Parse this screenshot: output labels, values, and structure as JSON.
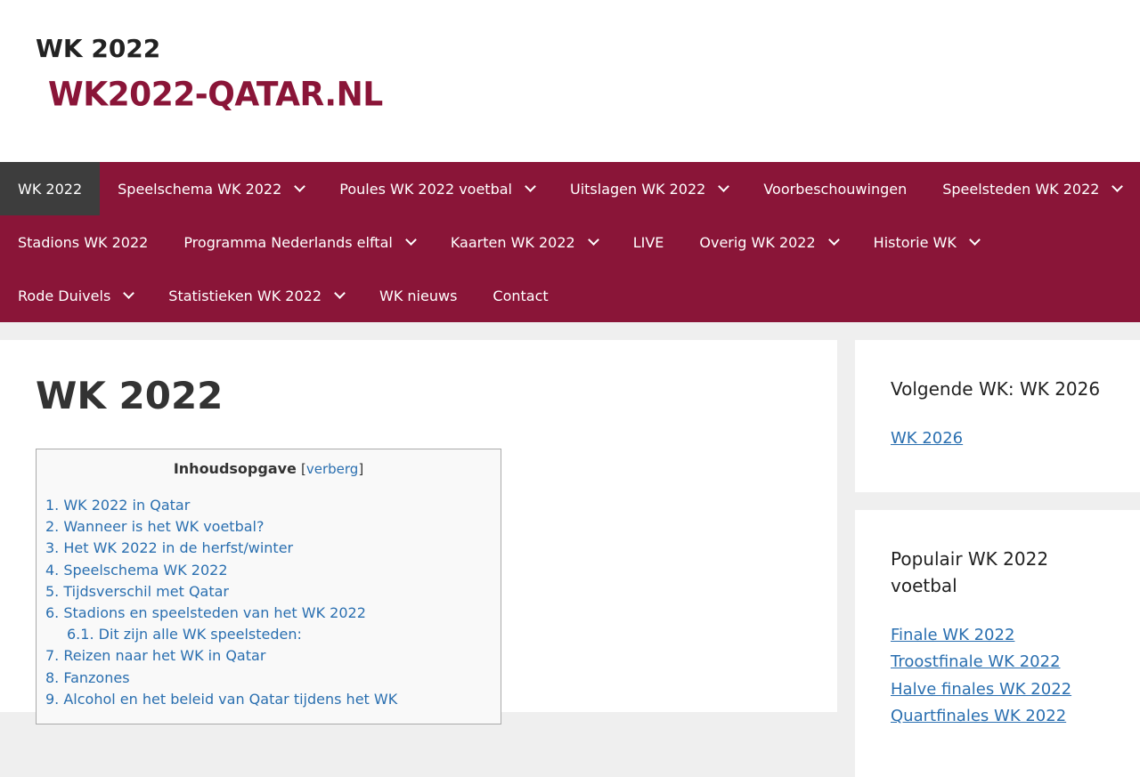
{
  "header": {
    "site_title": "WK 2022",
    "logo_text": "WK2022-QATAR.NL"
  },
  "nav": {
    "items": [
      {
        "label": "WK 2022",
        "dropdown": false,
        "active": true
      },
      {
        "label": "Speelschema WK 2022",
        "dropdown": true
      },
      {
        "label": "Poules WK 2022 voetbal",
        "dropdown": true
      },
      {
        "label": "Uitslagen WK 2022",
        "dropdown": true
      },
      {
        "label": "Voorbeschouwingen",
        "dropdown": false
      },
      {
        "label": "Speelsteden WK 2022",
        "dropdown": true
      },
      {
        "label": "Stadions WK 2022",
        "dropdown": false
      },
      {
        "label": "Programma Nederlands elftal",
        "dropdown": true
      },
      {
        "label": "Kaarten WK 2022",
        "dropdown": true
      },
      {
        "label": "LIVE",
        "dropdown": false
      },
      {
        "label": "Overig WK 2022",
        "dropdown": true
      },
      {
        "label": "Historie WK",
        "dropdown": true
      },
      {
        "label": "Rode Duivels",
        "dropdown": true
      },
      {
        "label": "Statistieken WK 2022",
        "dropdown": true
      },
      {
        "label": "WK nieuws",
        "dropdown": false
      },
      {
        "label": "Contact",
        "dropdown": false
      }
    ]
  },
  "main": {
    "page_title": "WK 2022",
    "toc": {
      "title": "Inhoudsopgave",
      "toggle_open": "[",
      "toggle_label": "verberg",
      "toggle_close": "]",
      "entries": [
        {
          "text": "1. WK 2022 in Qatar",
          "sub": false
        },
        {
          "text": "2. Wanneer is het WK voetbal?",
          "sub": false
        },
        {
          "text": "3. Het WK 2022 in de herfst/winter",
          "sub": false
        },
        {
          "text": "4. Speelschema WK 2022",
          "sub": false
        },
        {
          "text": "5. Tijdsverschil met Qatar",
          "sub": false
        },
        {
          "text": "6. Stadions en speelsteden van het WK 2022",
          "sub": false
        },
        {
          "text": "6.1. Dit zijn alle WK speelsteden:",
          "sub": true
        },
        {
          "text": "7. Reizen naar het WK in Qatar",
          "sub": false
        },
        {
          "text": "8. Fanzones",
          "sub": false
        },
        {
          "text": "9. Alcohol en het beleid van Qatar tijdens het WK",
          "sub": false
        }
      ]
    }
  },
  "sidebar": {
    "widget1": {
      "title": "Volgende WK: WK 2026",
      "links": [
        "WK 2026"
      ]
    },
    "widget2": {
      "title": "Populair WK 2022 voetbal",
      "links": [
        "Finale WK 2022",
        "Troostfinale WK 2022",
        "Halve finales WK 2022",
        "Quartfinales WK 2022"
      ]
    }
  },
  "colors": {
    "brand": "#8a1538",
    "active_nav": "#3d3d3d",
    "link": "#2a6fb0"
  }
}
